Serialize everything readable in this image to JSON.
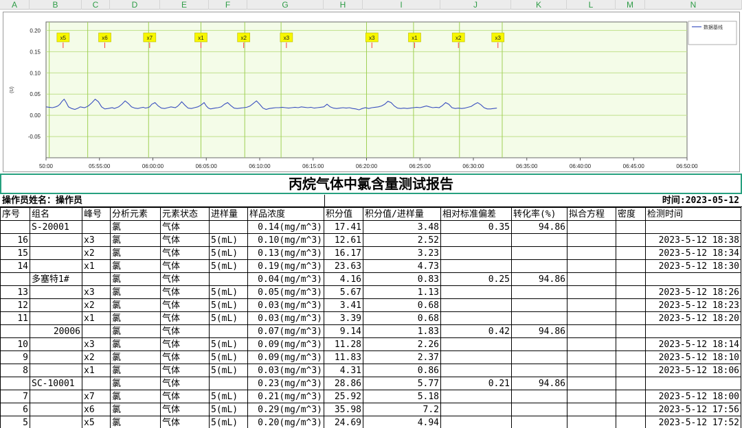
{
  "columns": [
    "A",
    "B",
    "C",
    "D",
    "E",
    "F",
    "G",
    "H",
    "I",
    "J",
    "K",
    "L",
    "M",
    "N"
  ],
  "chart_data": {
    "type": "line",
    "series": [
      {
        "name": "数据基线",
        "x": [
          0,
          0.3,
          0.6,
          0.9,
          1.1,
          1.3,
          1.5,
          1.7,
          1.9,
          2.1,
          2.4,
          2.7,
          3.0,
          3.2,
          3.4,
          3.6,
          3.8,
          4.0,
          4.3,
          4.6,
          4.9,
          5.2,
          5.5,
          5.8,
          6.0,
          6.2,
          6.4,
          6.6,
          6.8,
          7.1,
          7.4,
          7.7,
          8.0,
          8.3,
          8.6,
          8.9,
          9.1,
          9.3,
          9.5,
          9.7,
          9.9,
          10.2,
          10.5,
          10.8,
          11.1,
          11.4,
          11.7,
          11.9,
          12.1,
          12.3,
          12.5,
          12.7,
          13.0,
          13.3,
          13.6,
          13.9,
          14.2,
          14.5,
          14.8,
          15.0,
          15.2,
          15.4,
          15.6,
          15.8,
          16.1,
          16.4,
          16.7,
          17.0,
          17.3,
          17.6,
          17.9,
          18.2,
          18.5,
          18.8,
          19.1,
          19.4,
          19.7,
          20.0,
          20.3,
          20.6,
          20.9,
          21.2,
          21.5,
          21.8,
          22.1,
          22.4,
          22.7,
          23.0,
          23.3,
          23.6,
          23.9,
          24.2,
          24.5,
          24.8,
          25.1,
          25.4,
          25.7,
          26.0,
          26.3,
          26.6,
          26.9,
          27.2,
          27.5,
          27.8,
          28.1,
          28.4,
          28.7,
          29.0,
          29.3,
          29.6,
          29.9,
          30.2,
          30.5,
          30.8,
          31.1,
          31.4,
          31.7,
          32.0,
          32.3,
          32.6,
          32.9,
          33.2,
          33.5,
          33.8,
          34.1,
          34.4,
          34.7,
          35.0,
          35.3,
          35.6,
          35.9,
          36.2,
          36.5,
          36.8,
          37.1,
          37.4,
          37.7,
          38.0,
          38.3,
          38.6,
          38.9,
          39.2,
          39.5,
          39.8,
          40.1,
          40.4,
          40.7,
          41.0,
          41.3,
          41.6,
          41.9,
          42.2
        ],
        "y": [
          0.02,
          0.019,
          0.018,
          0.02,
          0.022,
          0.026,
          0.033,
          0.038,
          0.03,
          0.02,
          0.016,
          0.014,
          0.017,
          0.02,
          0.019,
          0.018,
          0.02,
          0.023,
          0.03,
          0.038,
          0.032,
          0.02,
          0.015,
          0.016,
          0.017,
          0.018,
          0.016,
          0.018,
          0.02,
          0.026,
          0.034,
          0.028,
          0.02,
          0.017,
          0.016,
          0.018,
          0.019,
          0.017,
          0.018,
          0.02,
          0.026,
          0.03,
          0.022,
          0.017,
          0.016,
          0.018,
          0.02,
          0.019,
          0.018,
          0.021,
          0.026,
          0.032,
          0.024,
          0.017,
          0.016,
          0.018,
          0.02,
          0.024,
          0.03,
          0.022,
          0.017,
          0.015,
          0.016,
          0.017,
          0.018,
          0.02,
          0.026,
          0.03,
          0.023,
          0.017,
          0.016,
          0.017,
          0.018,
          0.019,
          0.022,
          0.028,
          0.034,
          0.026,
          0.017,
          0.014,
          0.016,
          0.017,
          0.018,
          0.018,
          0.019,
          0.018,
          0.017,
          0.018,
          0.019,
          0.018,
          0.02,
          0.019,
          0.018,
          0.019,
          0.017,
          0.018,
          0.019,
          0.02,
          0.026,
          0.02,
          0.017,
          0.016,
          0.017,
          0.018,
          0.017,
          0.018,
          0.016,
          0.015,
          0.013,
          0.016,
          0.018,
          0.016,
          0.018,
          0.019,
          0.02,
          0.022,
          0.026,
          0.033,
          0.03,
          0.022,
          0.017,
          0.016,
          0.017,
          0.016,
          0.017,
          0.018,
          0.019,
          0.018,
          0.02,
          0.022,
          0.02,
          0.018,
          0.019,
          0.018,
          0.023,
          0.03,
          0.026,
          0.018,
          0.016,
          0.017,
          0.016,
          0.017,
          0.019,
          0.021,
          0.026,
          0.03,
          0.025,
          0.018,
          0.015,
          0.015,
          0.016,
          0.017
        ]
      }
    ],
    "peaks": [
      {
        "label": "x5",
        "x": 1.6
      },
      {
        "label": "x6",
        "x": 5.5
      },
      {
        "label": "x7",
        "x": 9.7
      },
      {
        "label": "x1",
        "x": 14.5
      },
      {
        "label": "x2",
        "x": 18.5
      },
      {
        "label": "x3",
        "x": 22.5
      },
      {
        "label": "x3",
        "x": 30.5
      },
      {
        "label": "x1",
        "x": 34.5
      },
      {
        "label": "x2",
        "x": 38.6
      },
      {
        "label": "x3",
        "x": 42.3
      }
    ],
    "segment_lines": [
      0.3,
      3.9,
      9.6,
      14.5,
      18.6,
      22.0,
      30.0,
      34.4,
      38.7,
      42.7
    ],
    "xlim": [
      0,
      60
    ],
    "ylim": [
      -0.1,
      0.22
    ],
    "y_ticks": [
      0.2,
      0.15,
      0.1,
      0.05,
      0.0,
      -0.05
    ],
    "y_tick_labels": [
      "0.20",
      "0.15",
      "0.10",
      "0.05",
      "0.00",
      "-0.05"
    ],
    "x_ticks": [
      0,
      5,
      10,
      15,
      20,
      25,
      30,
      35,
      40,
      45,
      50,
      55,
      60
    ],
    "x_tick_labels": [
      "50:00",
      "05:55:00",
      "06:00:00",
      "06:05:00",
      "06:10:00",
      "06:15:00",
      "06:20:00",
      "06:25:00",
      "06:30:00",
      "06:35:00",
      "06:40:00",
      "06:45:00",
      "06:50:00"
    ],
    "ylabel": "(U)",
    "legend": "数据基线",
    "legend_position": "top-right",
    "grid": true,
    "colors": {
      "line": "#3a4fbf",
      "plot_bg": "#f4fce8",
      "grid": "#bfe08a",
      "peak_label_bg": "#f7f700",
      "peak_marker": "#ff3b3b"
    }
  },
  "report": {
    "title": "丙烷气体中氯含量测试报告",
    "operator_label": "操作员姓名：操作员",
    "date_label": "时间:2023-05-12"
  },
  "table": {
    "headers": [
      "序号",
      "组名",
      "峰号",
      "分析元素",
      "元素状态",
      "进样量",
      "样品浓度",
      "积分值",
      "积分值/进样量",
      "相对标准偏差",
      "转化率(%)",
      "拟合方程",
      "密度",
      "检测时间"
    ],
    "rows": [
      {
        "seq": "",
        "group": "S-20001",
        "peak": "",
        "element": "氯",
        "state": "气体",
        "vol": "",
        "conc": "0.14(mg/m^3)",
        "integral": "17.41",
        "ratio": "3.48",
        "rsd": "0.35",
        "conv": "94.86",
        "eq": "",
        "density": "",
        "time": ""
      },
      {
        "seq": "16",
        "group": "",
        "peak": "x3",
        "element": "氯",
        "state": "气体",
        "vol": "5(mL)",
        "conc": "0.10(mg/m^3)",
        "integral": "12.61",
        "ratio": "2.52",
        "rsd": "",
        "conv": "",
        "eq": "",
        "density": "",
        "time": "2023-5-12 18:38"
      },
      {
        "seq": "15",
        "group": "",
        "peak": "x2",
        "element": "氯",
        "state": "气体",
        "vol": "5(mL)",
        "conc": "0.13(mg/m^3)",
        "integral": "16.17",
        "ratio": "3.23",
        "rsd": "",
        "conv": "",
        "eq": "",
        "density": "",
        "time": "2023-5-12 18:34"
      },
      {
        "seq": "14",
        "group": "",
        "peak": "x1",
        "element": "氯",
        "state": "气体",
        "vol": "5(mL)",
        "conc": "0.19(mg/m^3)",
        "integral": "23.63",
        "ratio": "4.73",
        "rsd": "",
        "conv": "",
        "eq": "",
        "density": "",
        "time": "2023-5-12 18:30"
      },
      {
        "seq": "",
        "group": "多塞特1#",
        "peak": "",
        "element": "氯",
        "state": "气体",
        "vol": "",
        "conc": "0.04(mg/m^3)",
        "integral": "4.16",
        "ratio": "0.83",
        "rsd": "0.25",
        "conv": "94.86",
        "eq": "",
        "density": "",
        "time": ""
      },
      {
        "seq": "13",
        "group": "",
        "peak": "x3",
        "element": "氯",
        "state": "气体",
        "vol": "5(mL)",
        "conc": "0.05(mg/m^3)",
        "integral": "5.67",
        "ratio": "1.13",
        "rsd": "",
        "conv": "",
        "eq": "",
        "density": "",
        "time": "2023-5-12 18:26"
      },
      {
        "seq": "12",
        "group": "",
        "peak": "x2",
        "element": "氯",
        "state": "气体",
        "vol": "5(mL)",
        "conc": "0.03(mg/m^3)",
        "integral": "3.41",
        "ratio": "0.68",
        "rsd": "",
        "conv": "",
        "eq": "",
        "density": "",
        "time": "2023-5-12 18:23"
      },
      {
        "seq": "11",
        "group": "",
        "peak": "x1",
        "element": "氯",
        "state": "气体",
        "vol": "5(mL)",
        "conc": "0.03(mg/m^3)",
        "integral": "3.39",
        "ratio": "0.68",
        "rsd": "",
        "conv": "",
        "eq": "",
        "density": "",
        "time": "2023-5-12 18:20"
      },
      {
        "seq": "",
        "group": "20006",
        "peak": "",
        "element": "氯",
        "state": "气体",
        "vol": "",
        "conc": "0.07(mg/m^3)",
        "integral": "9.14",
        "ratio": "1.83",
        "rsd": "0.42",
        "conv": "94.86",
        "eq": "",
        "density": "",
        "time": ""
      },
      {
        "seq": "10",
        "group": "",
        "peak": "x3",
        "element": "氯",
        "state": "气体",
        "vol": "5(mL)",
        "conc": "0.09(mg/m^3)",
        "integral": "11.28",
        "ratio": "2.26",
        "rsd": "",
        "conv": "",
        "eq": "",
        "density": "",
        "time": "2023-5-12 18:14"
      },
      {
        "seq": "9",
        "group": "",
        "peak": "x2",
        "element": "氯",
        "state": "气体",
        "vol": "5(mL)",
        "conc": "0.09(mg/m^3)",
        "integral": "11.83",
        "ratio": "2.37",
        "rsd": "",
        "conv": "",
        "eq": "",
        "density": "",
        "time": "2023-5-12 18:10"
      },
      {
        "seq": "8",
        "group": "",
        "peak": "x1",
        "element": "氯",
        "state": "气体",
        "vol": "5(mL)",
        "conc": "0.03(mg/m^3)",
        "integral": "4.31",
        "ratio": "0.86",
        "rsd": "",
        "conv": "",
        "eq": "",
        "density": "",
        "time": "2023-5-12 18:06"
      },
      {
        "seq": "",
        "group": "SC-10001",
        "peak": "",
        "element": "氯",
        "state": "气体",
        "vol": "",
        "conc": "0.23(mg/m^3)",
        "integral": "28.86",
        "ratio": "5.77",
        "rsd": "0.21",
        "conv": "94.86",
        "eq": "",
        "density": "",
        "time": ""
      },
      {
        "seq": "7",
        "group": "",
        "peak": "x7",
        "element": "氯",
        "state": "气体",
        "vol": "5(mL)",
        "conc": "0.21(mg/m^3)",
        "integral": "25.92",
        "ratio": "5.18",
        "rsd": "",
        "conv": "",
        "eq": "",
        "density": "",
        "time": "2023-5-12 18:00"
      },
      {
        "seq": "6",
        "group": "",
        "peak": "x6",
        "element": "氯",
        "state": "气体",
        "vol": "5(mL)",
        "conc": "0.29(mg/m^3)",
        "integral": "35.98",
        "ratio": "7.2",
        "rsd": "",
        "conv": "",
        "eq": "",
        "density": "",
        "time": "2023-5-12 17:56"
      },
      {
        "seq": "5",
        "group": "",
        "peak": "x5",
        "element": "氯",
        "state": "气体",
        "vol": "5(mL)",
        "conc": "0.20(mg/m^3)",
        "integral": "24.69",
        "ratio": "4.94",
        "rsd": "",
        "conv": "",
        "eq": "",
        "density": "",
        "time": "2023-5-12 17:52"
      }
    ]
  }
}
